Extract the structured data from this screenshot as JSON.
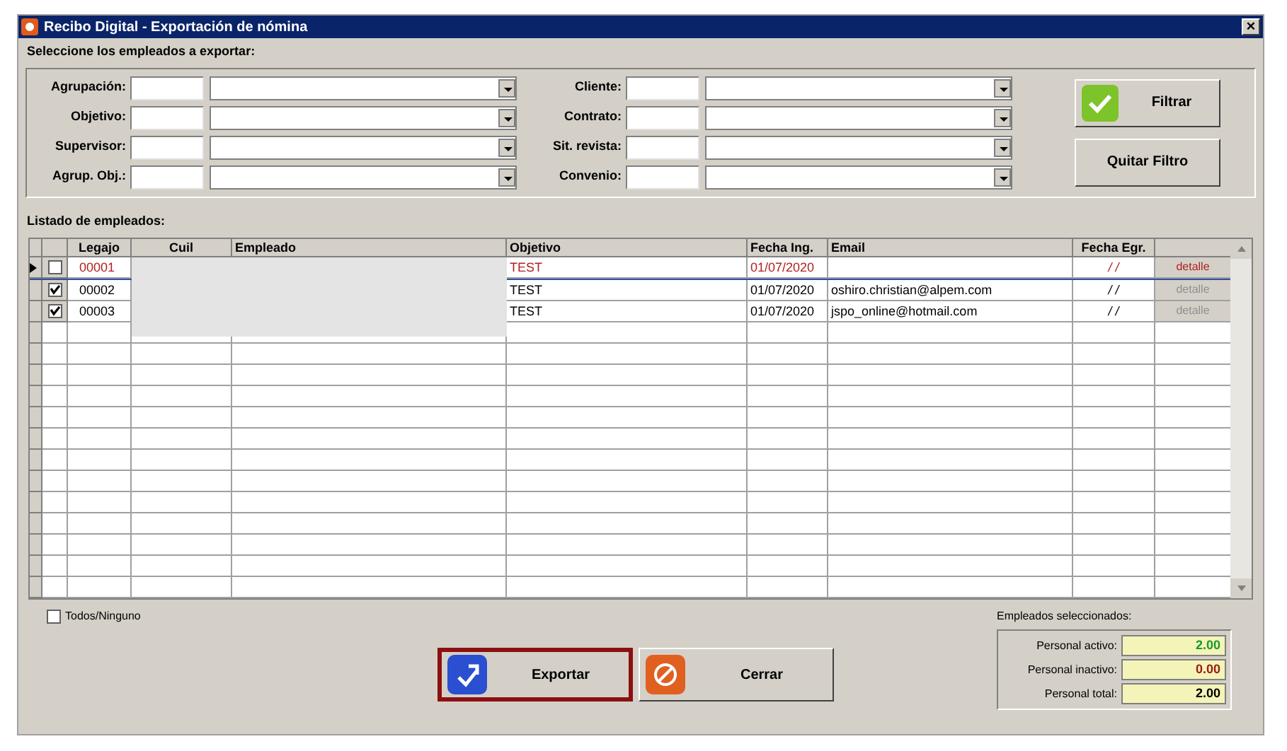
{
  "window": {
    "title": "Recibo Digital - Exportación de nómina",
    "close": "×"
  },
  "section_title": "Seleccione los empleados a exportar:",
  "filters_left": [
    {
      "label": "Agrupación:"
    },
    {
      "label": "Objetivo:"
    },
    {
      "label": "Supervisor:"
    },
    {
      "label": "Agrup. Obj.:"
    }
  ],
  "filters_right": [
    {
      "label": "Cliente:"
    },
    {
      "label": "Contrato:"
    },
    {
      "label": "Sit. revista:"
    },
    {
      "label": "Convenio:"
    }
  ],
  "filter_buttons": [
    {
      "kind": "check",
      "label": "Filtrar"
    },
    {
      "kind": "plain",
      "label": "Quitar Filtro"
    }
  ],
  "list_title": "Listado de empleados:",
  "table": {
    "columns": [
      "Legajo",
      "Cuil",
      "Empleado",
      "Objetivo",
      "Fecha Ing.",
      "Email",
      "Fecha Egr."
    ],
    "rows": [
      {
        "current": true,
        "checked": false,
        "legajo": "00001",
        "objetivo": "TEST",
        "fecha_ing": "01/07/2020",
        "email": "",
        "fecha_egr": "/ /",
        "action": "detalle"
      },
      {
        "current": false,
        "checked": true,
        "legajo": "00002",
        "objetivo": "TEST",
        "fecha_ing": "01/07/2020",
        "email": "oshiro.christian@alpem.com",
        "fecha_egr": "/ /",
        "action": "detalle"
      },
      {
        "current": false,
        "checked": true,
        "legajo": "00003",
        "objetivo": "TEST",
        "fecha_ing": "01/07/2020",
        "email": "jspo_online@hotmail.com",
        "fecha_egr": "/ /",
        "action": "detalle"
      }
    ]
  },
  "select_all": {
    "label": "Todos/Ninguno",
    "checked": false
  },
  "summary": {
    "title": "Empleados seleccionados:",
    "items": [
      {
        "label": "Personal activo:",
        "value": "2.00",
        "color": "#1a9a2a"
      },
      {
        "label": "Personal inactivo:",
        "value": "0.00",
        "color": "#9a1a1a"
      },
      {
        "label": "Personal total:",
        "value": "2.00",
        "color": "#000000"
      }
    ]
  },
  "action_buttons": [
    {
      "kind": "export",
      "label": "Exportar",
      "focused": true
    },
    {
      "kind": "close",
      "label": "Cerrar",
      "focused": false
    }
  ]
}
